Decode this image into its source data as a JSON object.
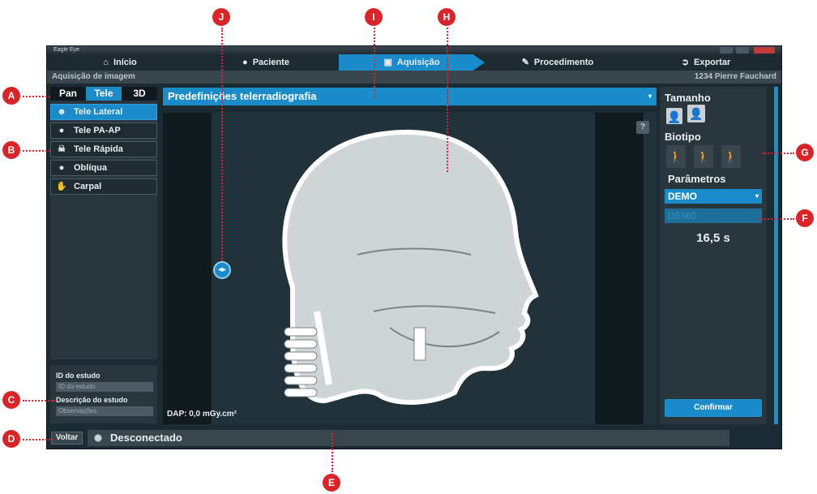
{
  "window": {
    "title": "Eagle Eye"
  },
  "nav": [
    {
      "icon": "home-icon",
      "glyph": "⌂",
      "label": "Início"
    },
    {
      "icon": "user-icon",
      "glyph": "●",
      "label": "Paciente"
    },
    {
      "icon": "camera-icon",
      "glyph": "▣",
      "label": "Aquisição"
    },
    {
      "icon": "edit-icon",
      "glyph": "✎",
      "label": "Procedimento"
    },
    {
      "icon": "export-icon",
      "glyph": "➲",
      "label": "Exportar"
    }
  ],
  "subbar": {
    "section": "Aquisição de imagem",
    "patient": "1234 Pierre Fauchard"
  },
  "modes": [
    "Pan",
    "Tele",
    "3D"
  ],
  "presets": [
    {
      "label": "Tele Lateral",
      "icon": "head-lateral-icon",
      "glyph": "☻"
    },
    {
      "label": "Tele PA-AP",
      "icon": "head-front-icon",
      "glyph": "●"
    },
    {
      "label": "Tele Rápida",
      "icon": "skull-icon",
      "glyph": "☠"
    },
    {
      "label": "Oblíqua",
      "icon": "head-oblique-icon",
      "glyph": "●"
    },
    {
      "label": "Carpal",
      "icon": "hand-icon",
      "glyph": "✋"
    }
  ],
  "study": {
    "id_label": "ID do estudo",
    "id_placeholder": "ID do estudo",
    "desc_label": "Descrição do estudo",
    "desc_placeholder": "Observações"
  },
  "back_label": "Voltar",
  "status": "Desconectado",
  "preset_bar": "Predefinições telerradiografia",
  "help": "?",
  "dap": "DAP: 0,0 mGy.cm²",
  "right": {
    "size_title": "Tamanho",
    "bio_title": "Biotipo",
    "params_title": "Parâmetros",
    "param1": "DEMO",
    "param2": "DEMO",
    "time": "16,5 s",
    "confirm": "Confirmar"
  },
  "callouts": [
    "A",
    "B",
    "C",
    "D",
    "E",
    "F",
    "G",
    "H",
    "I",
    "J"
  ],
  "colors": {
    "accent": "#1b8cc9",
    "callout": "#d9252a",
    "panel": "#2a363d"
  }
}
